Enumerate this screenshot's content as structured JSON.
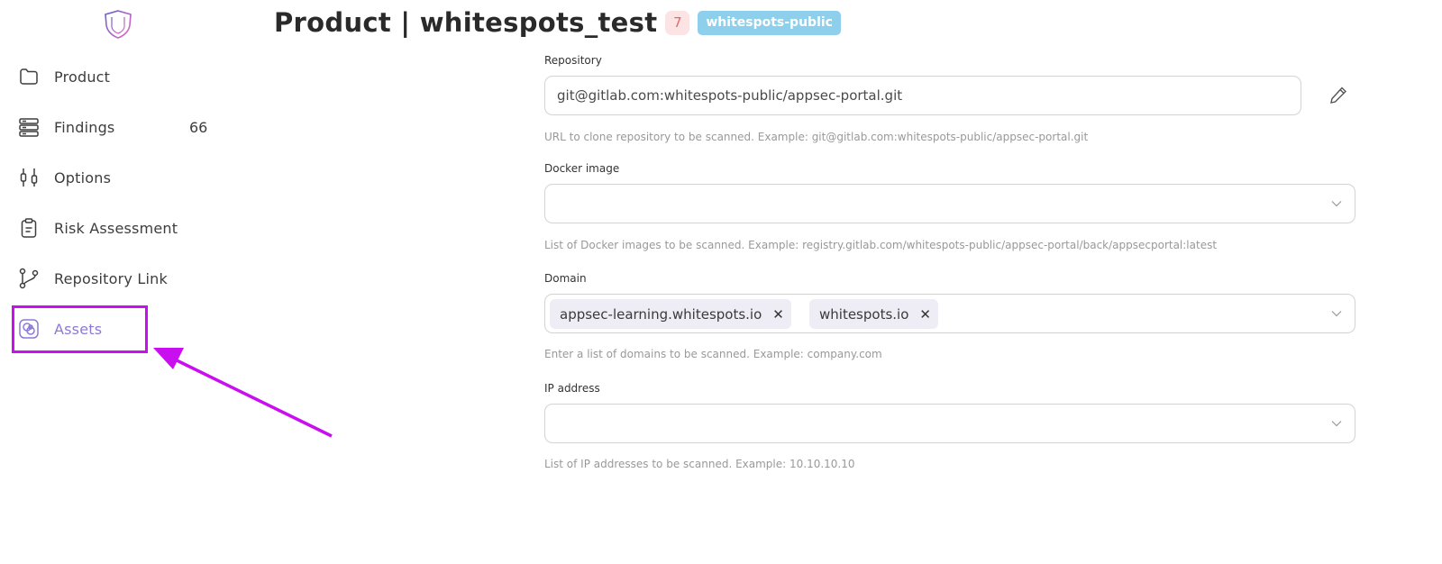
{
  "app": {
    "logo_icon": "shield-logo-icon"
  },
  "header": {
    "title": "Product | whitespots_test",
    "count_badge": "7",
    "tag": "whitespots-public",
    "colors": {
      "count_bg": "#fde4e4",
      "count_text": "#e06a6a",
      "tag_bg": "#8ecfeb"
    }
  },
  "sidebar": {
    "items": [
      {
        "label": "Product",
        "icon": "folder-icon"
      },
      {
        "label": "Findings",
        "icon": "server-icon",
        "count": "66"
      },
      {
        "label": "Options",
        "icon": "sliders-icon"
      },
      {
        "label": "Risk Assessment",
        "icon": "clipboard-icon"
      },
      {
        "label": "Repository Link",
        "icon": "git-branch-icon"
      },
      {
        "label": "Assets",
        "icon": "assets-icon",
        "active": true
      }
    ],
    "active_color": "#8e7ad6"
  },
  "annotation": {
    "highlight_color": "#c90ef0"
  },
  "form": {
    "repository": {
      "label": "Repository",
      "value": "git@gitlab.com:whitespots-public/appsec-portal.git",
      "help": "URL to clone repository to be scanned. Example: git@gitlab.com:whitespots-public/appsec-portal.git"
    },
    "docker": {
      "label": "Docker image",
      "value": "",
      "help": "List of Docker images to be scanned. Example: registry.gitlab.com/whitespots-public/appsec-portal/back/appsecportal:latest"
    },
    "domain": {
      "label": "Domain",
      "chips": [
        "appsec-learning.whitespots.io",
        "whitespots.io"
      ],
      "help": "Enter a list of domains to be scanned. Example: company.com"
    },
    "ip": {
      "label": "IP address",
      "value": "",
      "help": "List of IP addresses to be scanned. Example: 10.10.10.10"
    }
  }
}
